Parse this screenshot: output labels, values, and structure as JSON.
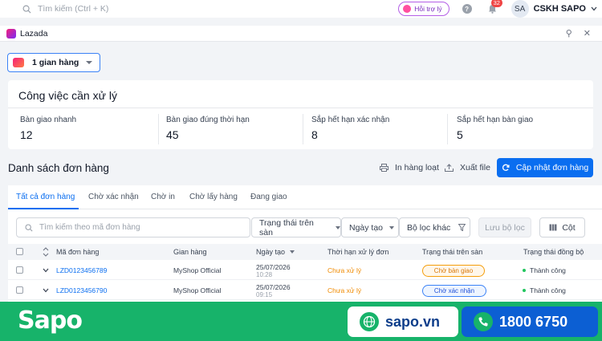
{
  "topbar": {
    "search_placeholder": "Tìm kiếm (Ctrl + K)",
    "help_label": "Hỗi trợ lý",
    "notification_count": "32",
    "avatar_initials": "SA",
    "username": "CSKH SAPO"
  },
  "app": {
    "name": "Lazada"
  },
  "store_selector": {
    "label": "1 gian hàng"
  },
  "tasks": {
    "title": "Công việc cần xử lý",
    "stats": [
      {
        "label": "Bàn giao nhanh",
        "value": "12"
      },
      {
        "label": "Bàn giao đúng thời hạn",
        "value": "45"
      },
      {
        "label": "Sắp hết hạn xác nhận",
        "value": "8"
      },
      {
        "label": "Sắp hết hạn bàn giao",
        "value": "5"
      }
    ]
  },
  "orders": {
    "title": "Danh sách đơn hàng",
    "actions": {
      "print_bulk": "In hàng loạt",
      "export": "Xuất file",
      "update": "Cập nhật đơn hàng"
    },
    "tabs": [
      "Tất cả đơn hàng",
      "Chờ xác nhận",
      "Chờ in",
      "Chờ lấy hàng",
      "Đang giao"
    ],
    "active_tab": 0,
    "filters": {
      "search_placeholder": "Tìm kiếm theo mã đơn hàng",
      "platform_status": "Trạng thái trên sàn",
      "created_date": "Ngày tạo",
      "other_filter": "Bộ lọc khác",
      "save_filter": "Lưu bộ lọc",
      "columns": "Cột"
    },
    "columns": [
      "Mã đơn hàng",
      "Gian hàng",
      "Ngày tạo",
      "Thời hạn xử lý đơn",
      "Trạng thái trên sàn",
      "Trạng thái đồng bộ"
    ],
    "rows": [
      {
        "code": "LZD0123456789",
        "store": "MyShop Official",
        "date": "25/07/2026",
        "time": "10:28",
        "deadline": "Chưa xử lý",
        "platform_status": "Chờ bàn giao",
        "sync_status": "Thành công"
      },
      {
        "code": "LZD0123456790",
        "store": "MyShop Official",
        "date": "25/07/2026",
        "time": "09:15",
        "deadline": "Chưa xử lý",
        "platform_status": "Chờ xác nhận",
        "sync_status": "Thành công"
      }
    ]
  },
  "banner": {
    "logo": "Sapo",
    "website": "sapo.vn",
    "hotline": "1800 6750"
  },
  "colors": {
    "primary": "#0a6ef0",
    "brand_green": "#17b36a",
    "warning": "#f08a00"
  }
}
